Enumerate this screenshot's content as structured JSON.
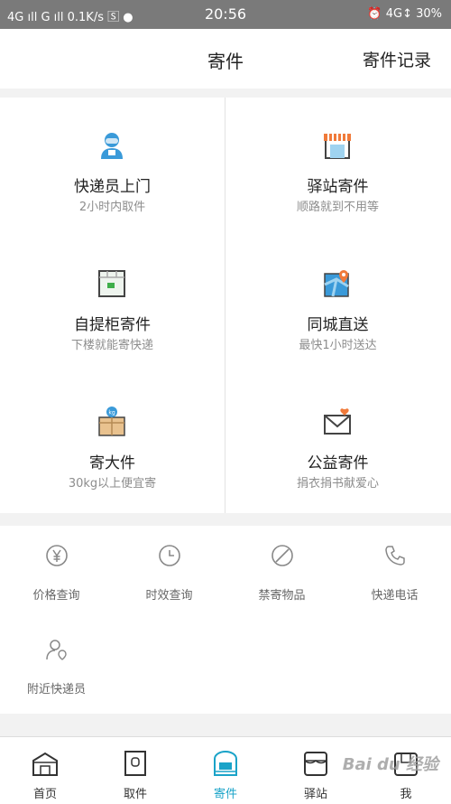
{
  "status_bar": {
    "left": "4G ıll G ıll 0.1K/s 🅂 ●",
    "time": "20:56",
    "right": "⏰ 4G↕ 30%"
  },
  "header": {
    "title": "寄件",
    "record_label": "寄件记录"
  },
  "services": [
    {
      "title": "快递员上门",
      "subtitle": "2小时内取件",
      "icon": "courier-icon"
    },
    {
      "title": "驿站寄件",
      "subtitle": "顺路就到不用等",
      "icon": "station-icon"
    },
    {
      "title": "自提柜寄件",
      "subtitle": "下楼就能寄快递",
      "icon": "locker-icon"
    },
    {
      "title": "同城直送",
      "subtitle": "最快1小时送达",
      "icon": "map-pin-icon"
    },
    {
      "title": "寄大件",
      "subtitle": "30kg以上便宜寄",
      "icon": "big-package-icon"
    },
    {
      "title": "公益寄件",
      "subtitle": "捐衣捐书献爱心",
      "icon": "charity-envelope-icon"
    }
  ],
  "tools": [
    {
      "label": "价格查询",
      "icon": "yen-icon"
    },
    {
      "label": "时效查询",
      "icon": "clock-icon"
    },
    {
      "label": "禁寄物品",
      "icon": "forbidden-icon"
    },
    {
      "label": "快递电话",
      "icon": "phone-icon"
    },
    {
      "label": "附近快递员",
      "icon": "courier-location-icon"
    }
  ],
  "tabs": [
    {
      "label": "首页",
      "icon": "home-icon",
      "active": false
    },
    {
      "label": "取件",
      "icon": "pickup-icon",
      "active": false
    },
    {
      "label": "寄件",
      "icon": "send-icon",
      "active": true
    },
    {
      "label": "驿站",
      "icon": "station-tab-icon",
      "active": false
    },
    {
      "label": "我",
      "icon": "profile-icon",
      "active": false
    }
  ],
  "watermark": "Bai du 经验",
  "colors": {
    "accent": "#1aa3c8",
    "orange": "#f07a3a",
    "blue": "#3a9ad9"
  }
}
